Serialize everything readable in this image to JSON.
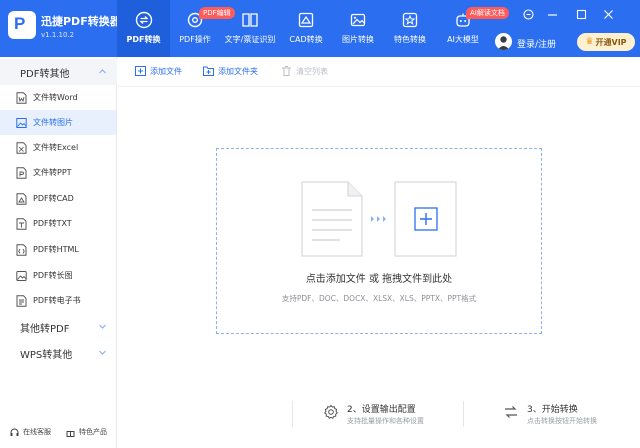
{
  "app": {
    "title": "迅捷PDF转换器",
    "version": "v1.1.10.2",
    "logo_letter": "P"
  },
  "nav_tabs": [
    {
      "label": "PDF转换",
      "icon": "convert-arrows-icon",
      "active": true
    },
    {
      "label": "PDF操作",
      "icon": "gear-icon",
      "badge": "PDF编辑"
    },
    {
      "label": "文字/票证识别",
      "icon": "book-scan-icon"
    },
    {
      "label": "CAD转换",
      "icon": "cad-box-icon"
    },
    {
      "label": "图片转换",
      "icon": "image-icon"
    },
    {
      "label": "特色转换",
      "icon": "star-box-icon"
    },
    {
      "label": "AI大模型",
      "icon": "robot-icon",
      "badge": "AI解读文档"
    }
  ],
  "header_right": {
    "login": "登录/注册",
    "vip": "开通VIP"
  },
  "sidebar": {
    "categories": [
      {
        "label": "PDF转其他",
        "expanded": true
      },
      {
        "label": "其他转PDF"
      },
      {
        "label": "WPS转其他"
      }
    ],
    "items": [
      {
        "label": "文件转Word",
        "icon": "word-file-icon"
      },
      {
        "label": "文件转图片",
        "icon": "image-file-icon",
        "active": true
      },
      {
        "label": "文件转Excel",
        "icon": "excel-file-icon"
      },
      {
        "label": "文件转PPT",
        "icon": "ppt-file-icon"
      },
      {
        "label": "PDF转CAD",
        "icon": "cad-file-icon"
      },
      {
        "label": "PDF转TXT",
        "icon": "txt-file-icon"
      },
      {
        "label": "PDF转HTML",
        "icon": "html-file-icon"
      },
      {
        "label": "PDF转长图",
        "icon": "long-image-icon"
      },
      {
        "label": "PDF转电子书",
        "icon": "ebook-icon"
      }
    ],
    "footer": [
      {
        "label": "在线客服",
        "icon": "headset-icon"
      },
      {
        "label": "特色产品",
        "icon": "gift-icon"
      }
    ]
  },
  "toolbar": {
    "add_file": "添加文件",
    "add_folder": "添加文件夹",
    "clear_list": "清空列表"
  },
  "dropzone": {
    "main_text": "点击添加文件 或 拖拽文件到此处",
    "sub_text": "支持PDF、DOC、DOCX、XLSX、XLS、PPTX、PPT格式"
  },
  "steps": [
    {
      "title": "2、设置输出配置",
      "desc": "支持批量操作和各种设置",
      "icon": "gear-icon"
    },
    {
      "title": "3、开始转换",
      "desc": "点击转换按钮开始转换",
      "icon": "convert-icon"
    }
  ],
  "colors": {
    "primary": "#2b6ff0",
    "active_tab": "#1f5fdc",
    "badge": "#ff5b5b",
    "vip_bg": "#fff1d0",
    "dashed_border": "#8fb0ee"
  }
}
